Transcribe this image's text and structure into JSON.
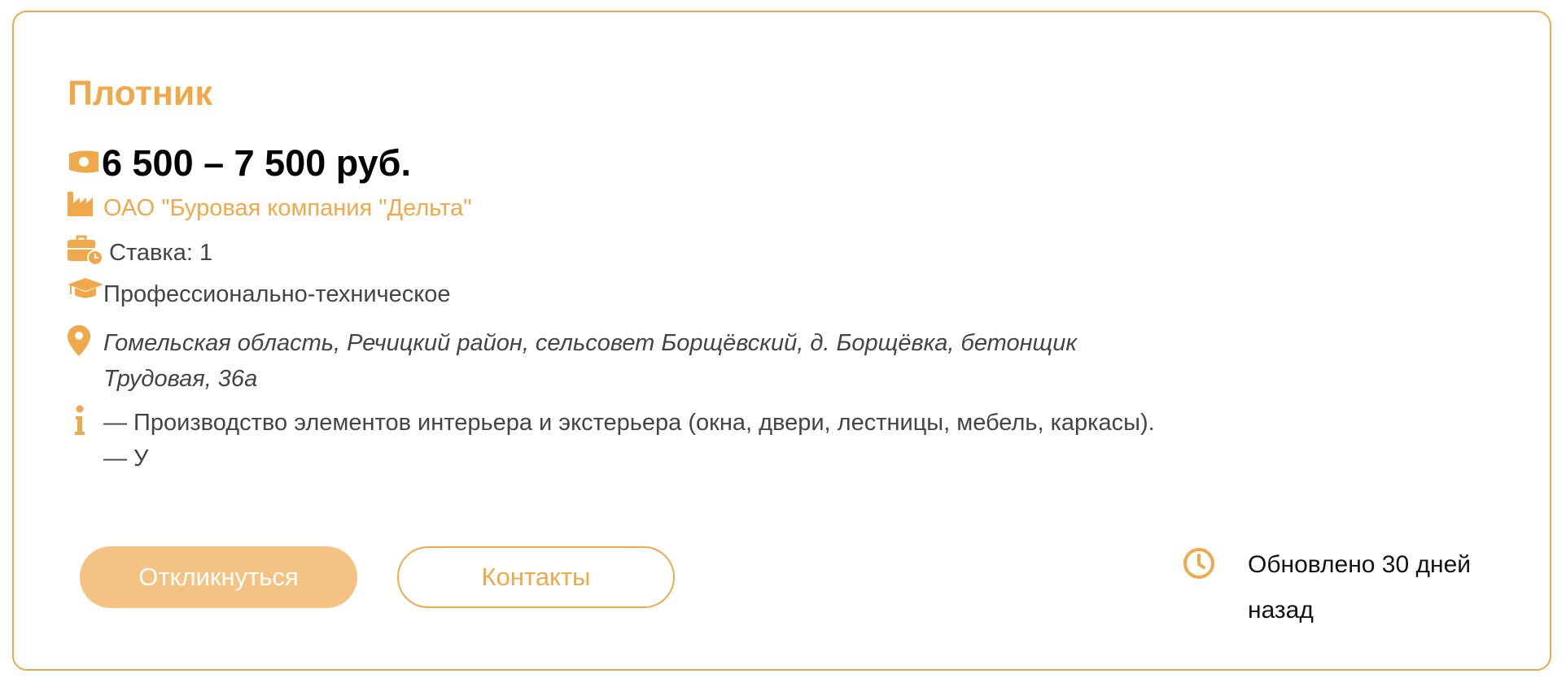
{
  "job": {
    "title": "Плотник",
    "salary": "6 500 – 7 500 руб.",
    "company": "ОАО \"Буровая компания \"Дельта\"",
    "rate": "Ставка: 1",
    "education": "Профессионально-техническое",
    "address": "Гомельская область, Речицкий район, сельсовет Борщёвский, д. Борщёвка, бетонщик Трудовая, 36а",
    "description": "— Производство элементов интерьера и экстерьера (окна, двери, лестницы, мебель, каркасы). — У"
  },
  "actions": {
    "apply_label": "Откликнуться",
    "contacts_label": "Контакты"
  },
  "meta": {
    "updated": "Обновлено 30 дней назад"
  },
  "icons": {
    "salary": "money-icon",
    "company": "factory-icon",
    "rate": "briefcase-clock-icon",
    "education": "graduation-cap-icon",
    "address": "map-pin-icon",
    "description": "info-icon",
    "updated": "clock-icon"
  },
  "colors": {
    "accent": "#f0a94a",
    "button_fill": "#f4c384"
  }
}
